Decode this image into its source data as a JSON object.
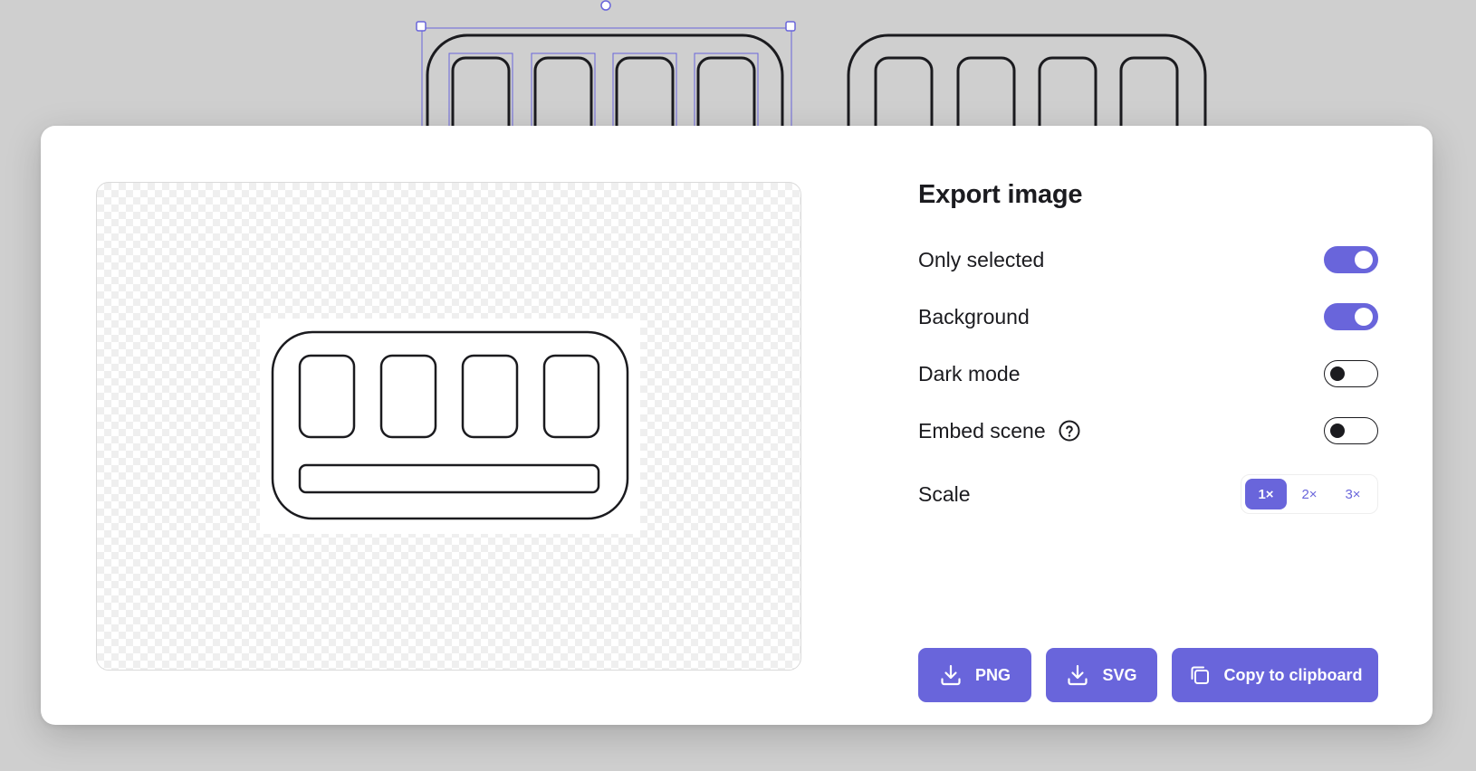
{
  "dialog": {
    "title": "Export image",
    "options": [
      {
        "label": "Only selected",
        "enabled": true
      },
      {
        "label": "Background",
        "enabled": true
      },
      {
        "label": "Dark mode",
        "enabled": false
      },
      {
        "label": "Embed scene",
        "enabled": false,
        "has_help_icon": true
      }
    ],
    "scale": {
      "label": "Scale",
      "options": [
        "1×",
        "2×",
        "3×"
      ],
      "selected": "1×"
    },
    "buttons": {
      "png_label": "PNG",
      "svg_label": "SVG",
      "copy_label": "Copy to clipboard"
    }
  },
  "icons": {
    "help": "question-circle-icon",
    "download": "download-icon",
    "copy": "copy-icon",
    "toggle_knob": "toggle-knob"
  },
  "colors": {
    "accent": "#6965db",
    "text": "#1b1b1f",
    "canvas_background": "#cfcfcf",
    "selection": "#6965db"
  }
}
